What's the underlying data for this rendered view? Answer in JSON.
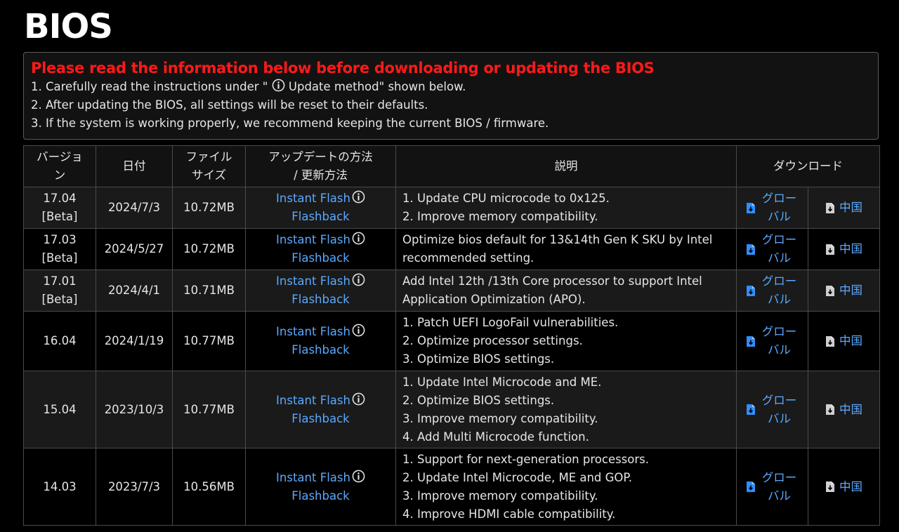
{
  "page": {
    "title": "BIOS"
  },
  "notice": {
    "heading": "Please read the information below before downloading or updating the BIOS",
    "line1_prefix": "1. Carefully read the instructions under \"",
    "line1_suffix": "Update method\" shown below.",
    "line2": "2. After updating the BIOS, all settings will be reset to their defaults.",
    "line3": "3. If the system is working properly, we recommend keeping the current BIOS / firmware."
  },
  "table": {
    "headers": {
      "version": [
        "バージョ",
        "ン"
      ],
      "date": "日付",
      "size": [
        "ファイル",
        "サイズ"
      ],
      "method": [
        "アップデートの方法",
        "/ 更新方法"
      ],
      "description": "説明",
      "download": "ダウンロード"
    },
    "links": {
      "instant_flash": "Instant Flash",
      "flashback": "Flashback",
      "global": "グローバル",
      "china": "中国"
    },
    "rows": [
      {
        "version": "17.04",
        "tag": "[Beta]",
        "date": "2024/7/3",
        "size": "10.72MB",
        "description": [
          "1. Update CPU microcode to 0x125.",
          "2. Improve memory compatibility."
        ]
      },
      {
        "version": "17.03",
        "tag": "[Beta]",
        "date": "2024/5/27",
        "size": "10.72MB",
        "description": [
          "Optimize bios default for 13&14th Gen K SKU by Intel",
          "recommended setting."
        ]
      },
      {
        "version": "17.01",
        "tag": "[Beta]",
        "date": "2024/4/1",
        "size": "10.71MB",
        "description": [
          "Add Intel 12th /13th Core processor to support Intel",
          "Application Optimization (APO)."
        ]
      },
      {
        "version": "16.04",
        "tag": "",
        "date": "2024/1/19",
        "size": "10.77MB",
        "description": [
          "1. Patch UEFI LogoFail vulnerabilities.",
          "2. Optimize processor settings.",
          "3. Optimize BIOS settings."
        ]
      },
      {
        "version": "15.04",
        "tag": "",
        "date": "2023/10/3",
        "size": "10.77MB",
        "description": [
          "1. Update Intel Microcode and ME.",
          "2. Optimize BIOS settings.",
          "3. Improve memory compatibility.",
          "4. Add Multi Microcode function."
        ]
      },
      {
        "version": "14.03",
        "tag": "",
        "date": "2023/7/3",
        "size": "10.56MB",
        "description": [
          "1. Support for next-generation processors.",
          "2. Update Intel Microcode, ME and GOP.",
          "3. Improve memory compatibility.",
          "4. Improve HDMI cable compatibility."
        ]
      }
    ]
  },
  "colors": {
    "background": "#000000",
    "warning": "#ff1a1a",
    "link": "#5aa9ff",
    "global_icon": "#2e8fff",
    "china_icon": "#d0d0d0"
  },
  "icons": {
    "info": "info-circle-icon",
    "global_download": "file-download-icon",
    "china_download": "file-download-icon"
  }
}
